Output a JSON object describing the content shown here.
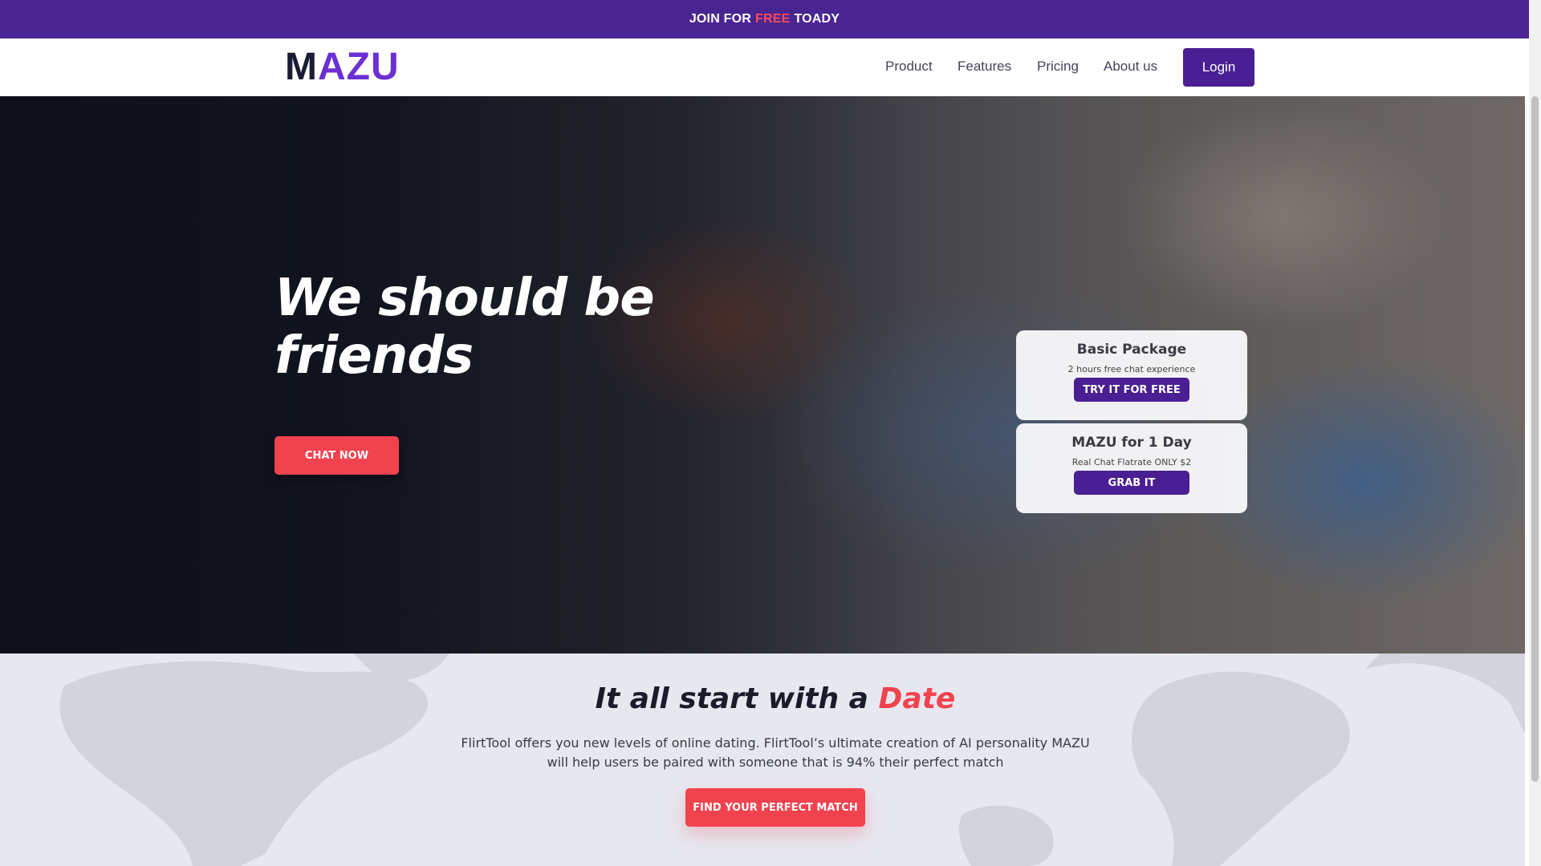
{
  "topbar": {
    "prefix": "JOIN FOR",
    "highlight": "FREE",
    "suffix": "TOADY"
  },
  "brand": {
    "logo_first": "M",
    "logo_rest": "AZU",
    "primary_color": "#4a1f93",
    "accent_color": "#f1434f"
  },
  "nav": {
    "items": [
      {
        "label": "Product"
      },
      {
        "label": "Features"
      },
      {
        "label": "Pricing"
      },
      {
        "label": "About us"
      }
    ],
    "login_label": "Login"
  },
  "hero": {
    "title_line1": "We should be",
    "title_line2": "friends",
    "cta_label": "CHAT NOW"
  },
  "packages": [
    {
      "title": "Basic Package",
      "desc": "2 hours free chat experience",
      "button": "TRY IT FOR FREE"
    },
    {
      "title": "MAZU for 1 Day",
      "desc": "Real Chat Flatrate ONLY $2",
      "button": "GRAB IT"
    }
  ],
  "date_section": {
    "title_prefix": "It all start with a",
    "title_accent": "Date",
    "description": "FlirtTool offers you new levels of online dating. FlirtTool’s ultimate creation of AI personality MAZU will help users be paired with someone that is 94% their perfect match",
    "cta_label": "FIND YOUR PERFECT MATCH"
  }
}
